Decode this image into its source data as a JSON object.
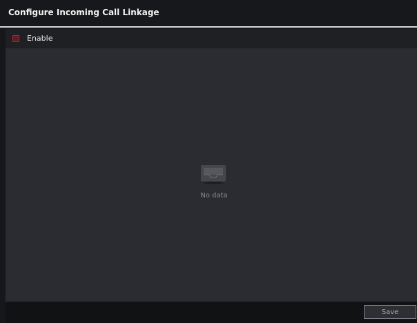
{
  "dialog": {
    "title": "Configure Incoming Call Linkage",
    "enable_label": "Enable",
    "enable_checked": false,
    "empty_state": {
      "icon": "empty-box-icon",
      "message": "No data"
    },
    "save_label": "Save"
  },
  "colors": {
    "background": "#16171a",
    "panel": "#2a2c31",
    "accent": "#a32a33",
    "text": "#f2f2f2"
  }
}
